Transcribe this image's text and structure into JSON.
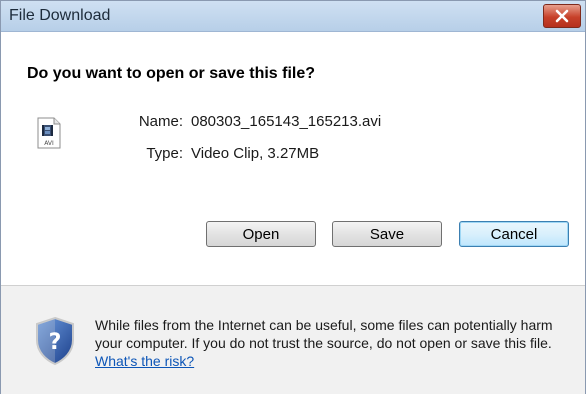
{
  "window": {
    "title": "File Download",
    "close_icon": "close-icon"
  },
  "main": {
    "question": "Do you want to open or save this file?",
    "file_icon": "avi-file-icon",
    "name_label": "Name:",
    "name_value": "080303_165143_165213.avi",
    "type_label": "Type:",
    "type_value": "Video Clip, 3.27MB"
  },
  "buttons": {
    "open": "Open",
    "save": "Save",
    "cancel": "Cancel"
  },
  "footer": {
    "shield_icon": "security-shield-icon",
    "warning_text": "While files from the Internet can be useful, some files can potentially harm your computer. If you do not trust the source, do not open or save this file. ",
    "risk_link": "What's the risk?"
  },
  "colors": {
    "close_red": "#c7412a",
    "link_blue": "#0c55b7",
    "titlebar_blue": "#b7cfe8"
  }
}
